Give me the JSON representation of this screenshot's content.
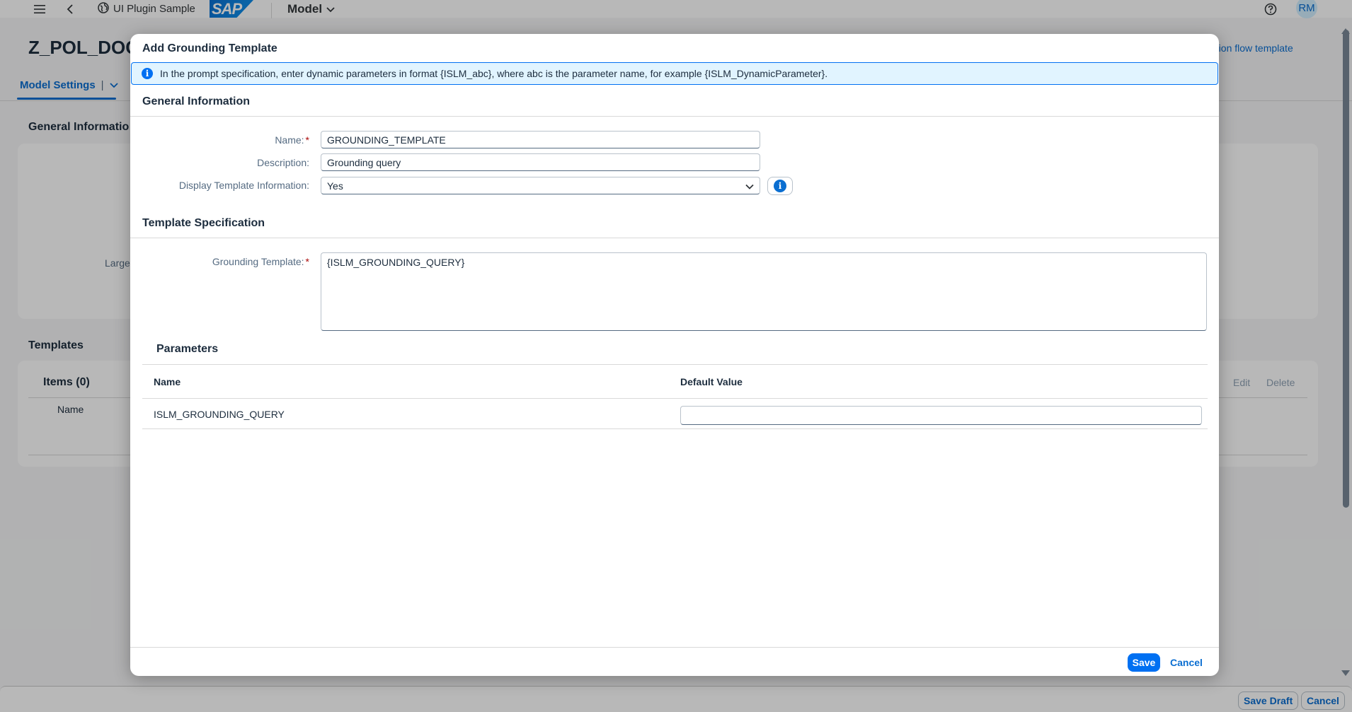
{
  "shell": {
    "app_title": "UI Plugin Sample",
    "logo_text": "SAP",
    "model_menu": "Model",
    "avatar_initials": "RM"
  },
  "background": {
    "object_title": "Z_POL_DOC",
    "toolbar_link": "ution flow template",
    "tab_label": "Model Settings",
    "general_info_title": "General Informatio",
    "large_label": "Large",
    "templates_title": "Templates",
    "items_title": "Items (0)",
    "column_name": "Name",
    "edit_label": "Edit",
    "delete_label": "Delete",
    "footer_save_draft": "Save Draft",
    "footer_cancel": "Cancel"
  },
  "dialog": {
    "title": "Add Grounding Template",
    "info_message": "In the prompt specification, enter dynamic parameters in format {ISLM_abc}, where abc is the parameter name, for example {ISLM_DynamicParameter}.",
    "general_section_title": "General Information",
    "fields": {
      "name_label": "Name:",
      "name_value": "GROUNDING_TEMPLATE",
      "description_label": "Description:",
      "description_value": "Grounding query",
      "display_info_label": "Display Template Information:",
      "display_info_value": "Yes"
    },
    "spec_section_title": "Template Specification",
    "grounding_label": "Grounding Template:",
    "grounding_value": "{ISLM_GROUNDING_QUERY}",
    "parameters": {
      "title": "Parameters",
      "columns": [
        "Name",
        "Default Value"
      ],
      "rows": [
        {
          "name": "ISLM_GROUNDING_QUERY",
          "default_value": ""
        }
      ]
    },
    "save_label": "Save",
    "cancel_label": "Cancel"
  },
  "colors": {
    "brand": "#0070f2",
    "link": "#0a6ed1",
    "required": "#aa0808",
    "info_strip_bg": "#e1f4ff"
  }
}
